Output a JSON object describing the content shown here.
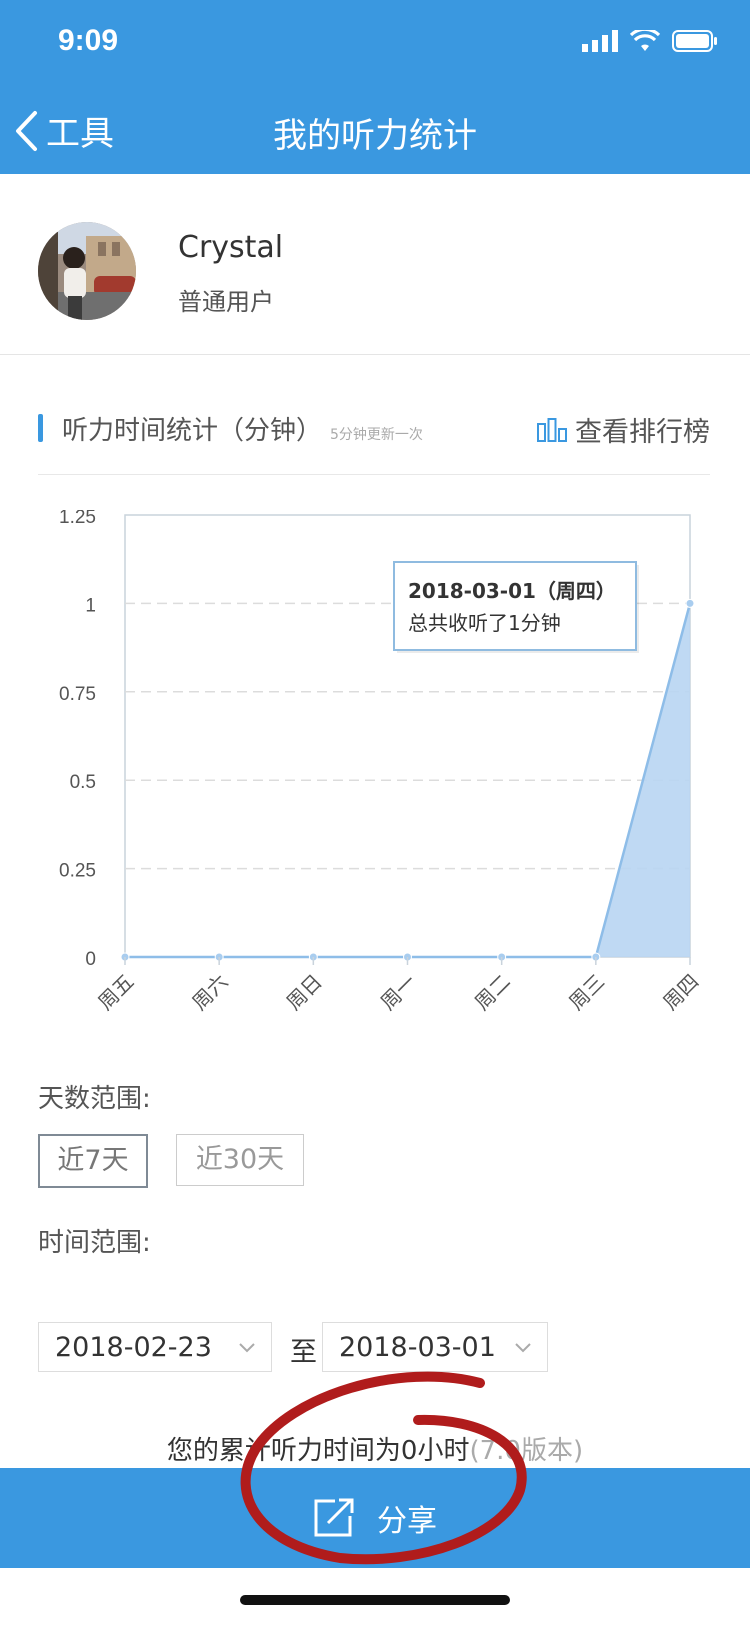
{
  "status_bar": {
    "time": "9:09"
  },
  "navbar": {
    "back_label": "工具",
    "title": "我的听力统计"
  },
  "profile": {
    "name": "Crystal",
    "user_type": "普通用户"
  },
  "stats": {
    "title": "听力时间统计（分钟）",
    "note": "5分钟更新一次",
    "ranking_label": "查看排行榜"
  },
  "chart_data": {
    "type": "area",
    "categories": [
      "周五",
      "周六",
      "周日",
      "周一",
      "周二",
      "周三",
      "周四"
    ],
    "values": [
      0,
      0,
      0,
      0,
      0,
      0,
      1
    ],
    "y_ticks": [
      "1.25",
      "1",
      "0.75",
      "0.5",
      "0.25",
      "0"
    ],
    "ylim": [
      0,
      1.25
    ],
    "grid": true,
    "tooltip": {
      "title": "2018-03-01（周四）",
      "text": "总共收听了1分钟"
    },
    "color": "#3a98e0",
    "fill": "#b8d5f2"
  },
  "filters": {
    "day_range_label": "天数范围:",
    "day_options": [
      "近7天",
      "近30天"
    ],
    "active_option": "近7天",
    "time_range_label": "时间范围:",
    "start_date": "2018-02-23",
    "to_label": "至",
    "end_date": "2018-03-01"
  },
  "summary": {
    "text": "您的累计听力时间为0小时",
    "version": "(7.0版本)"
  },
  "share": {
    "label": "分享"
  },
  "colors": {
    "primary": "#3a98e0",
    "annotation": "#b01c1c"
  }
}
